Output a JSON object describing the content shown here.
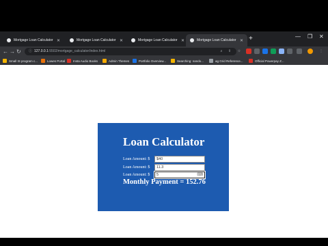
{
  "browser": {
    "tabs": [
      {
        "title": "Mortgage Loan Calculator",
        "active": false
      },
      {
        "title": "Mortgage Loan Calculator",
        "active": false
      },
      {
        "title": "Mortgage Loan Calculator",
        "active": false
      },
      {
        "title": "Mortgage Loan Calculator",
        "active": true
      }
    ],
    "new_tab_icon": "+",
    "url_host": "127.0.0.1",
    "url_path": ":5502/mortgage_calculator/index.html",
    "bookmarks": [
      {
        "label": "Small IS program c...",
        "color": "#f4b400"
      },
      {
        "label": "Lowes Portal",
        "color": "#e8710a"
      },
      {
        "label": "Insta Audio Books",
        "color": "#d93025"
      },
      {
        "label": "Admin Themes",
        "color": "#f9ab00"
      },
      {
        "label": "Portfolio Overview...",
        "color": "#1a73e8"
      },
      {
        "label": "Searching: nando...",
        "color": "#f4b400"
      },
      {
        "label": "ag Grid Reference...",
        "color": "#9aa0a6"
      },
      {
        "label": "Official Powerpay Z...",
        "color": "#d93025"
      }
    ]
  },
  "calculator": {
    "title": "Loan Calculator",
    "fields": [
      {
        "label": "Loan Amount: $",
        "value": "$40"
      },
      {
        "label": "Loan Amount: $",
        "value": "11.3"
      },
      {
        "label": "Loan Amount: $",
        "value": "5"
      }
    ],
    "result": "Monthly Payment = 152.76"
  }
}
